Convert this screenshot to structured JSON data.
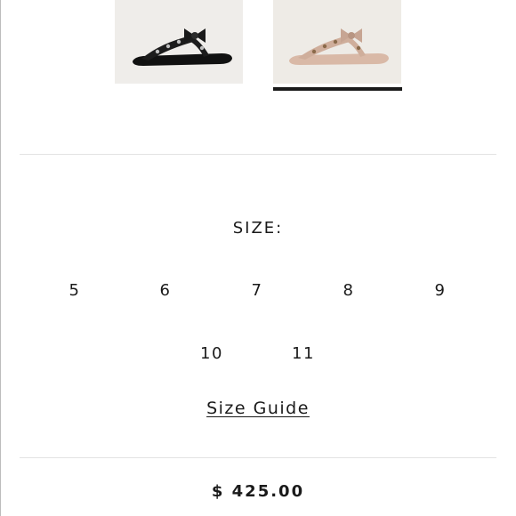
{
  "product": {
    "swatches": [
      {
        "color_name": "black",
        "sandal_color": "#111111",
        "selected": false
      },
      {
        "color_name": "nude",
        "sandal_color": "#d9b9a7",
        "selected": true
      }
    ]
  },
  "size_selector": {
    "heading": "SIZE:",
    "row_1": [
      "5",
      "6",
      "7",
      "8",
      "9"
    ],
    "row_2": [
      "10",
      "11"
    ]
  },
  "size_guide_link": "Size Guide",
  "price": "$ 425.00",
  "colors": {
    "text": "#1a1a1a",
    "divider": "#e3e3e3",
    "swatch_bg": "#efedea"
  }
}
